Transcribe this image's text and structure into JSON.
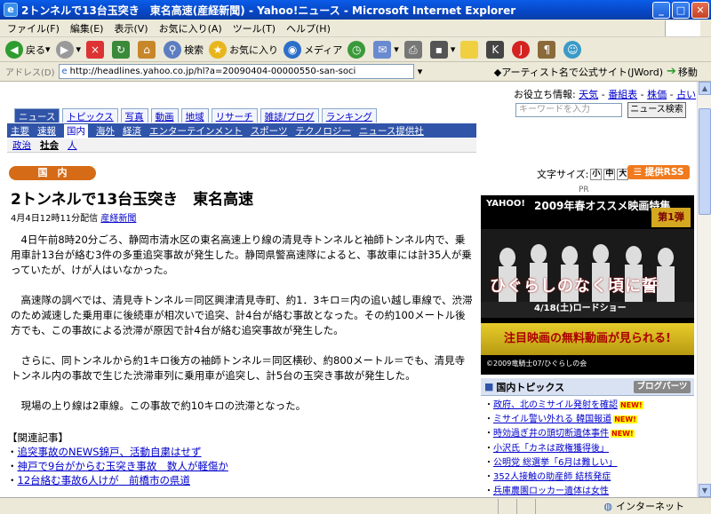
{
  "window": {
    "title": "2トンネルで13台玉突き　東名高速(産経新聞) - Yahoo!ニュース - Microsoft Internet Explorer"
  },
  "menu": [
    "ファイル(F)",
    "編集(E)",
    "表示(V)",
    "お気に入り(A)",
    "ツール(T)",
    "ヘルプ(H)"
  ],
  "toolbar": {
    "back": "戻る",
    "search": "検索",
    "favorites": "お気に入り",
    "media": "メディア"
  },
  "address": {
    "label": "アドレス(D)",
    "url": "http://headlines.yahoo.co.jp/hl?a=20090404-00000550-san-soci",
    "search_hint": "◆アーティスト名で公式サイト(JWord)",
    "go": "移動"
  },
  "helper": {
    "label": "お役立ち情報:",
    "links": [
      "天気",
      "番組表",
      "株価",
      "占い"
    ]
  },
  "search": {
    "placeholder": "キーワードを入力",
    "button": "ニュース検索"
  },
  "tabs1": [
    "ニュース",
    "トピックス",
    "写真",
    "動画",
    "地域",
    "リサーチ",
    "雑誌/ブログ",
    "ランキング"
  ],
  "nav2": [
    "主要",
    "速報",
    "国内",
    "海外",
    "経済",
    "エンターテインメント",
    "スポーツ",
    "テクノロジー",
    "ニュース提供社"
  ],
  "nav3": [
    "政治",
    "社会",
    "人"
  ],
  "category": "国　内",
  "font_size": {
    "label": "文字サイズ:",
    "small": "小",
    "medium": "中",
    "large": "大"
  },
  "rss": "提供RSS",
  "article": {
    "headline": "2トンネルで13台玉突き　東名高速",
    "date": "4月4日12時11分配信",
    "source": "産経新聞",
    "paragraphs": [
      "4日午前8時20分ごろ、静岡市清水区の東名高速上り線の清見寺トンネルと袖師トンネル内で、乗用車計13台が絡む3件の多重追突事故が発生した。静岡県警高速隊によると、事故車には計35人が乗っていたが、けが人はいなかった。",
      "高速隊の調べでは、清見寺トンネル＝同区興津清見寺町、約1．3キロ＝内の追い越し車線で、渋滞のため減速した乗用車に後続車が相次いで追突、計4台が絡む事故となった。その約100メートル後方でも、この事故による渋滞が原因で計4台が絡む追突事故が発生した。",
      "さらに、同トンネルから約1キロ後方の袖師トンネル＝同区横砂、約800メートル＝でも、清見寺トンネル内の事故で生じた渋滞車列に乗用車が追突し、計5台の玉突き事故が発生した。",
      "現場の上り線は2車線。この事故で約10キロの渋滞となった。"
    ],
    "related_title": "【関連記事】",
    "related": [
      "追突事故のNEWS錦戸、活動自粛はせず",
      "神戸で9台がからむ玉突き事故　数人が軽傷か",
      "12台絡む事故6人けが　前橋市の県道"
    ]
  },
  "pr": "PR",
  "ad": {
    "logo": "YAHOO!",
    "head": "2009年春オススメ映画特集",
    "badge": "第1弾",
    "movie": "ひぐらしのなく頃に誓",
    "date": "4/18(土)ロードショー",
    "cta": "注目映画の無料動画が見られる!",
    "copy": "©2009竜騎士07/ひぐらしの会"
  },
  "topics": {
    "title": "国内トピックス",
    "blog_btn": "ブログパーツ",
    "items": [
      {
        "text": "政府、北のミサイル発射を確認",
        "new": "NEW!"
      },
      {
        "text": "ミサイル警い外れる 韓国報道",
        "new": "NEW!"
      },
      {
        "text": "時効過ぎ井の頭切断遺体事件",
        "new": "NEW!"
      },
      {
        "text": "小沢氏「カネは政権獲得後」",
        "new": ""
      },
      {
        "text": "公明党 総選挙「6月は難しい」",
        "new": ""
      },
      {
        "text": "352人接触の助産師 結核発症",
        "new": ""
      },
      {
        "text": "兵庫農園ロッカー遺体は女性",
        "new": ""
      }
    ]
  },
  "status": {
    "zone": "インターネット"
  }
}
